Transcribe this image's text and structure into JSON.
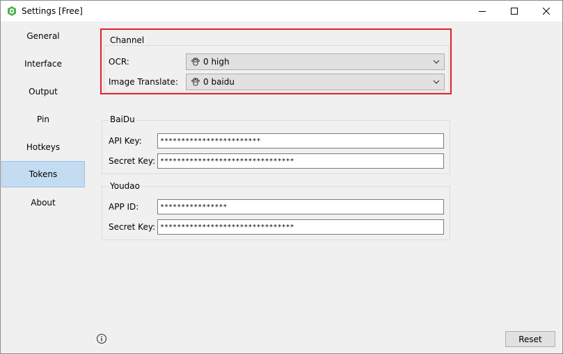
{
  "window": {
    "title": "Settings [Free]"
  },
  "sidebar": {
    "items": [
      {
        "label": "General"
      },
      {
        "label": "Interface"
      },
      {
        "label": "Output"
      },
      {
        "label": "Pin"
      },
      {
        "label": "Hotkeys"
      },
      {
        "label": "Tokens",
        "active": true
      },
      {
        "label": "About"
      }
    ]
  },
  "channel": {
    "title": "Channel",
    "ocr_label": "OCR:",
    "ocr_value": "0 high",
    "image_translate_label": "Image Translate:",
    "image_translate_value": "0 baidu"
  },
  "baidu": {
    "title": "BaiDu",
    "api_key_label": "API Key:",
    "api_key_value": "************************",
    "secret_key_label": "Secret Key:",
    "secret_key_value": "********************************"
  },
  "youdao": {
    "title": "Youdao",
    "app_id_label": "APP ID:",
    "app_id_value": "****************",
    "secret_key_label": "Secret Key:",
    "secret_key_value": "********************************"
  },
  "footer": {
    "reset_label": "Reset"
  },
  "colors": {
    "highlight": "#e0202a",
    "active_nav": "#c4dcf2",
    "app_icon": "#4caf50"
  },
  "icons": {
    "app": "app-logo-icon",
    "info": "info-icon",
    "dropdown": "chevron-down-icon",
    "combo_item": "paw-icon"
  }
}
